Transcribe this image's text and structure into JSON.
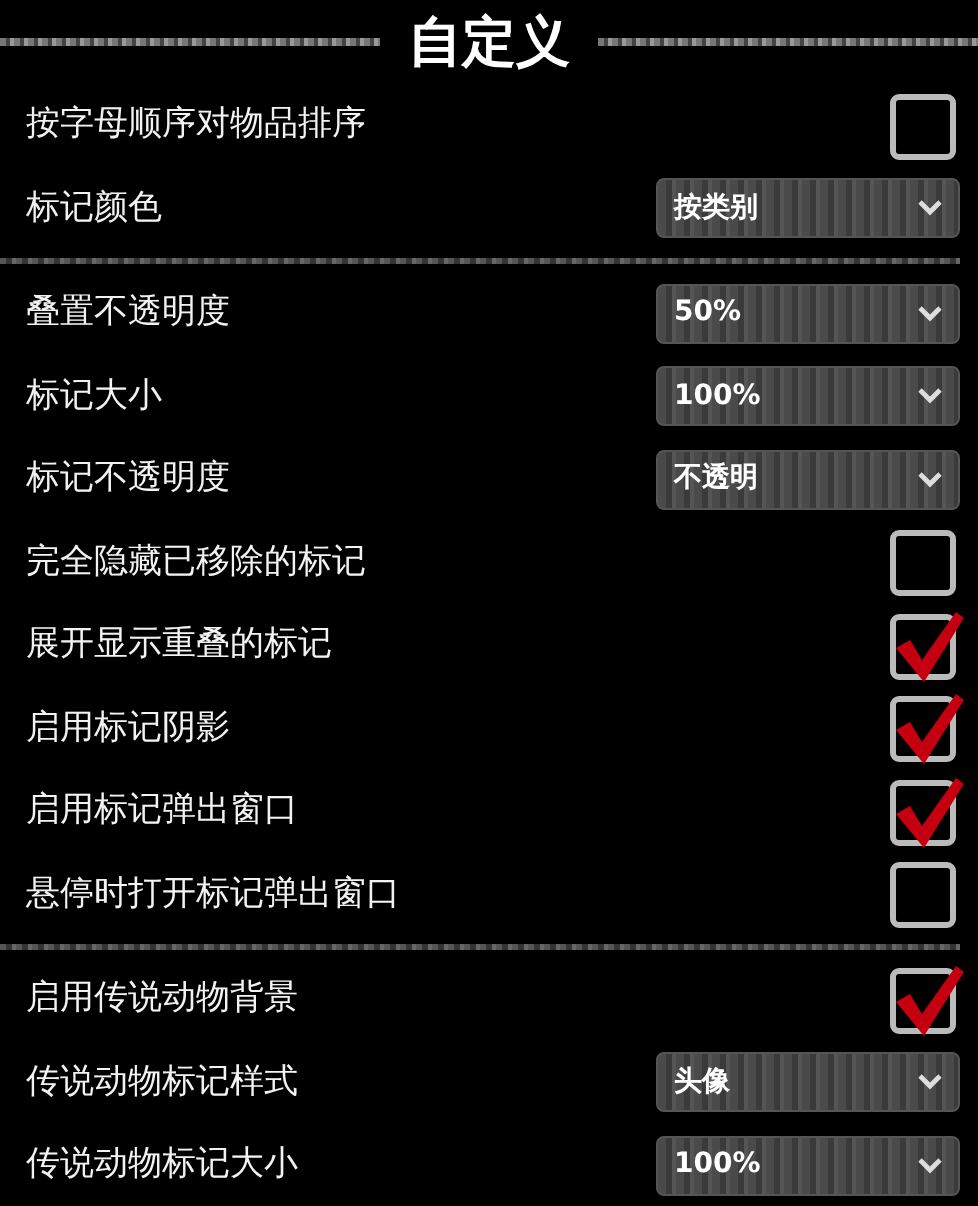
{
  "title": "自定义",
  "sections": [
    {
      "rows": [
        {
          "kind": "checkbox",
          "label": "按字母顺序对物品排序",
          "checked": false
        },
        {
          "kind": "dropdown",
          "label": "标记颜色",
          "value": "按类别"
        }
      ]
    },
    {
      "rows": [
        {
          "kind": "dropdown",
          "label": "叠置不透明度",
          "value": "50%"
        },
        {
          "kind": "dropdown",
          "label": "标记大小",
          "value": "100%"
        },
        {
          "kind": "dropdown",
          "label": "标记不透明度",
          "value": "不透明"
        },
        {
          "kind": "checkbox",
          "label": "完全隐藏已移除的标记",
          "checked": false
        },
        {
          "kind": "checkbox",
          "label": "展开显示重叠的标记",
          "checked": true
        },
        {
          "kind": "checkbox",
          "label": "启用标记阴影",
          "checked": true
        },
        {
          "kind": "checkbox",
          "label": "启用标记弹出窗口",
          "checked": true
        },
        {
          "kind": "checkbox",
          "label": "悬停时打开标记弹出窗口",
          "checked": false
        }
      ]
    },
    {
      "rows": [
        {
          "kind": "checkbox",
          "label": "启用传说动物背景",
          "checked": true
        },
        {
          "kind": "dropdown",
          "label": "传说动物标记样式",
          "value": "头像"
        },
        {
          "kind": "dropdown",
          "label": "传说动物标记大小",
          "value": "100%"
        }
      ]
    }
  ]
}
